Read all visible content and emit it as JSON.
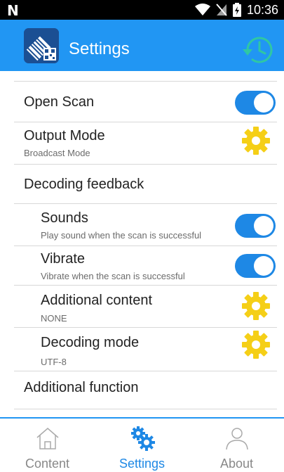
{
  "status_bar": {
    "time": "10:36",
    "icons": [
      "n-notification-icon",
      "wifi-icon",
      "no-sim-icon",
      "battery-icon"
    ]
  },
  "app_bar": {
    "title": "Settings",
    "logo_icon": "barcode-logo-icon",
    "action_icon": "history-icon"
  },
  "settings": {
    "open_scan": {
      "title": "Open Scan",
      "enabled": true
    },
    "output_mode": {
      "title": "Output Mode",
      "value": "Broadcast Mode"
    },
    "decoding_feedback": {
      "section": "Decoding feedback",
      "sounds": {
        "title": "Sounds",
        "desc": "Play sound when the scan is successful",
        "enabled": true
      },
      "vibrate": {
        "title": "Vibrate",
        "desc": "Vibrate when the scan is successful",
        "enabled": true
      },
      "additional_content": {
        "title": "Additional content",
        "value": "NONE"
      },
      "decoding_mode": {
        "title": "Decoding mode",
        "value": "UTF-8"
      }
    },
    "additional_function": {
      "section": "Additional function"
    }
  },
  "bottom_nav": {
    "items": [
      {
        "label": "Content",
        "icon": "home-icon",
        "active": false
      },
      {
        "label": "Settings",
        "icon": "gears-icon",
        "active": true
      },
      {
        "label": "About",
        "icon": "person-icon",
        "active": false
      }
    ]
  },
  "colors": {
    "primary": "#2196f3",
    "toggle_on": "#1e88e5",
    "gear": "#f5cf17",
    "history_icon": "#2fc7a4",
    "nav_inactive": "#888888"
  }
}
